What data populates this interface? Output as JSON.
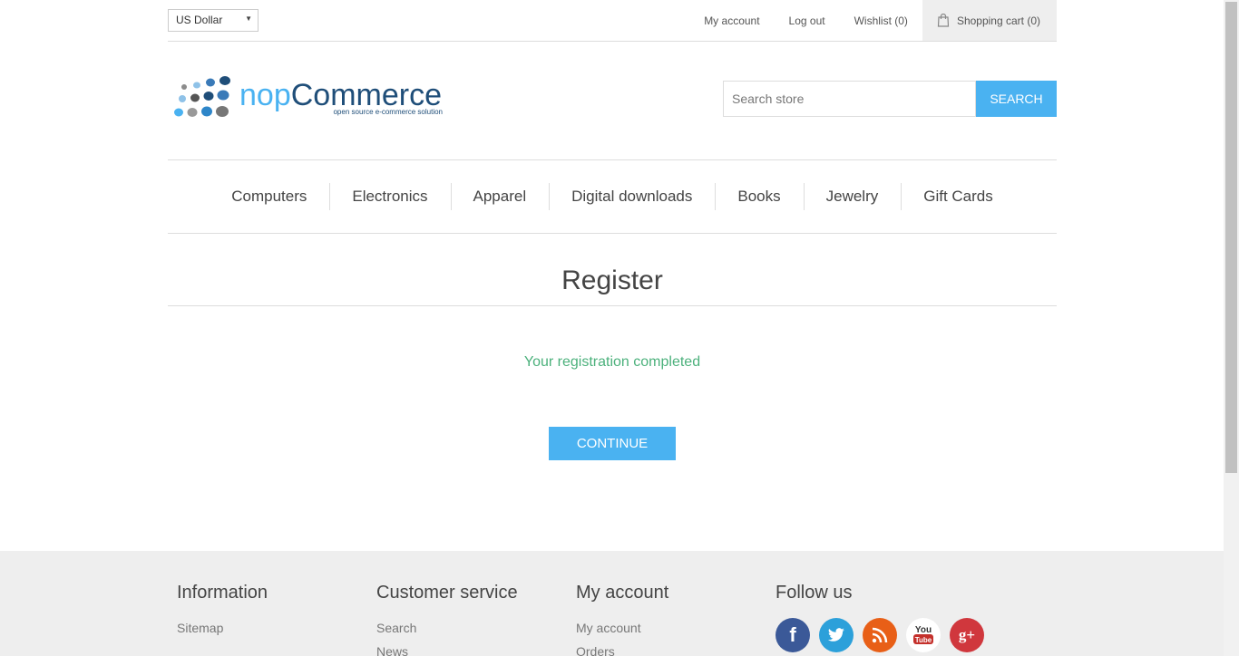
{
  "header": {
    "currency": "US Dollar",
    "links": {
      "my_account": "My account",
      "log_out": "Log out",
      "wishlist": "Wishlist (0)",
      "shopping_cart": "Shopping cart (0)"
    }
  },
  "logo": {
    "brand": "nopCommerce",
    "tagline": "open source e-commerce solution"
  },
  "search": {
    "placeholder": "Search store",
    "button": "SEARCH"
  },
  "menu": [
    "Computers",
    "Electronics",
    "Apparel",
    "Digital downloads",
    "Books",
    "Jewelry",
    "Gift Cards"
  ],
  "page": {
    "title": "Register",
    "result": "Your registration completed",
    "continue": "CONTINUE"
  },
  "footer": {
    "information": {
      "title": "Information",
      "links": [
        "Sitemap"
      ]
    },
    "customer_service": {
      "title": "Customer service",
      "links": [
        "Search",
        "News"
      ]
    },
    "my_account": {
      "title": "My account",
      "links": [
        "My account",
        "Orders"
      ]
    },
    "follow_us": {
      "title": "Follow us",
      "social": [
        "facebook-icon",
        "twitter-icon",
        "rss-icon",
        "youtube-icon",
        "google-plus-icon"
      ]
    }
  },
  "colors": {
    "accent": "#4ab2f1",
    "success": "#4cb17c",
    "facebook": "#3b5998",
    "twitter": "#2ca0da",
    "rss": "#e85f17",
    "google_plus": "#d0373d"
  }
}
